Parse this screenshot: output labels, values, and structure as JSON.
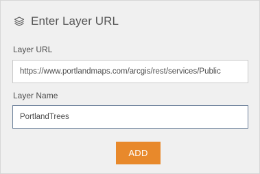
{
  "header": {
    "title": "Enter Layer URL",
    "icon": "layers-icon"
  },
  "form": {
    "url_label": "Layer URL",
    "url_value": "https://www.portlandmaps.com/arcgis/rest/services/Public",
    "name_label": "Layer Name",
    "name_value": "PortlandTrees",
    "add_label": "ADD"
  },
  "colors": {
    "accent": "#e8892b",
    "panel_background": "#f0f0f0",
    "focused_border": "#6b7f99"
  }
}
